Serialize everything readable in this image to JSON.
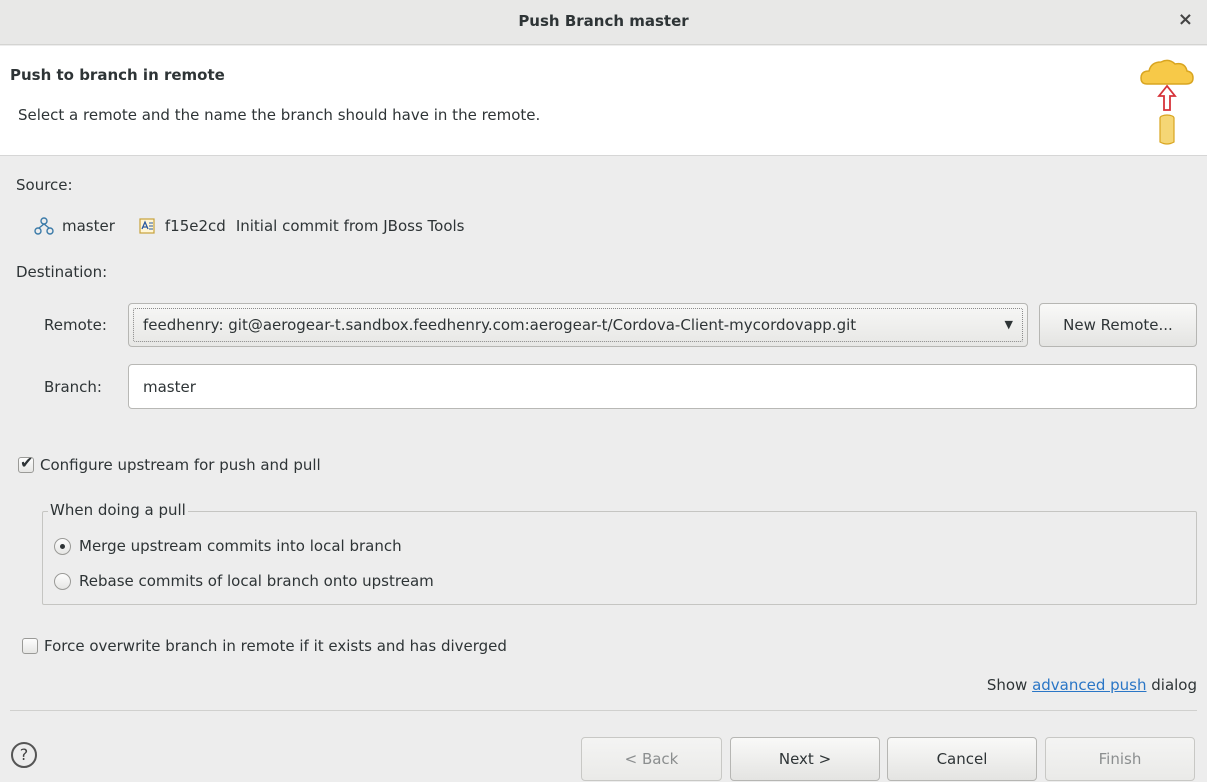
{
  "window": {
    "title": "Push Branch master",
    "close": "×"
  },
  "banner": {
    "title": "Push to branch in remote",
    "description": "Select a remote and the name the branch should have in the remote."
  },
  "source": {
    "label": "Source:",
    "branch": "master",
    "commit_id": "f15e2cd",
    "commit_message": "Initial commit from JBoss Tools"
  },
  "destination": {
    "label": "Destination:",
    "remote_label": "Remote:",
    "remote_value": "feedhenry: git@aerogear-t.sandbox.feedhenry.com:aerogear-t/Cordova-Client-mycordovapp.git",
    "new_remote_button": "New Remote...",
    "branch_label": "Branch:",
    "branch_value": "master"
  },
  "options": {
    "configure_upstream": "Configure upstream for push and pull",
    "configure_upstream_checked": true,
    "pull_group_title": "When doing a pull",
    "merge_option": "Merge upstream commits into local branch",
    "rebase_option": "Rebase commits of local branch onto upstream",
    "selected_pull_option": "merge",
    "force_overwrite": "Force overwrite branch in remote if it exists and has diverged",
    "force_overwrite_checked": false
  },
  "advanced": {
    "prefix": "Show ",
    "link": "advanced push",
    "suffix": " dialog"
  },
  "footer": {
    "help": "?",
    "back": "< Back",
    "next": "Next >",
    "cancel": "Cancel",
    "finish": "Finish"
  },
  "icons": {
    "banner": "cloud-push-icon",
    "branch": "branch-icon",
    "commit": "commit-icon"
  }
}
